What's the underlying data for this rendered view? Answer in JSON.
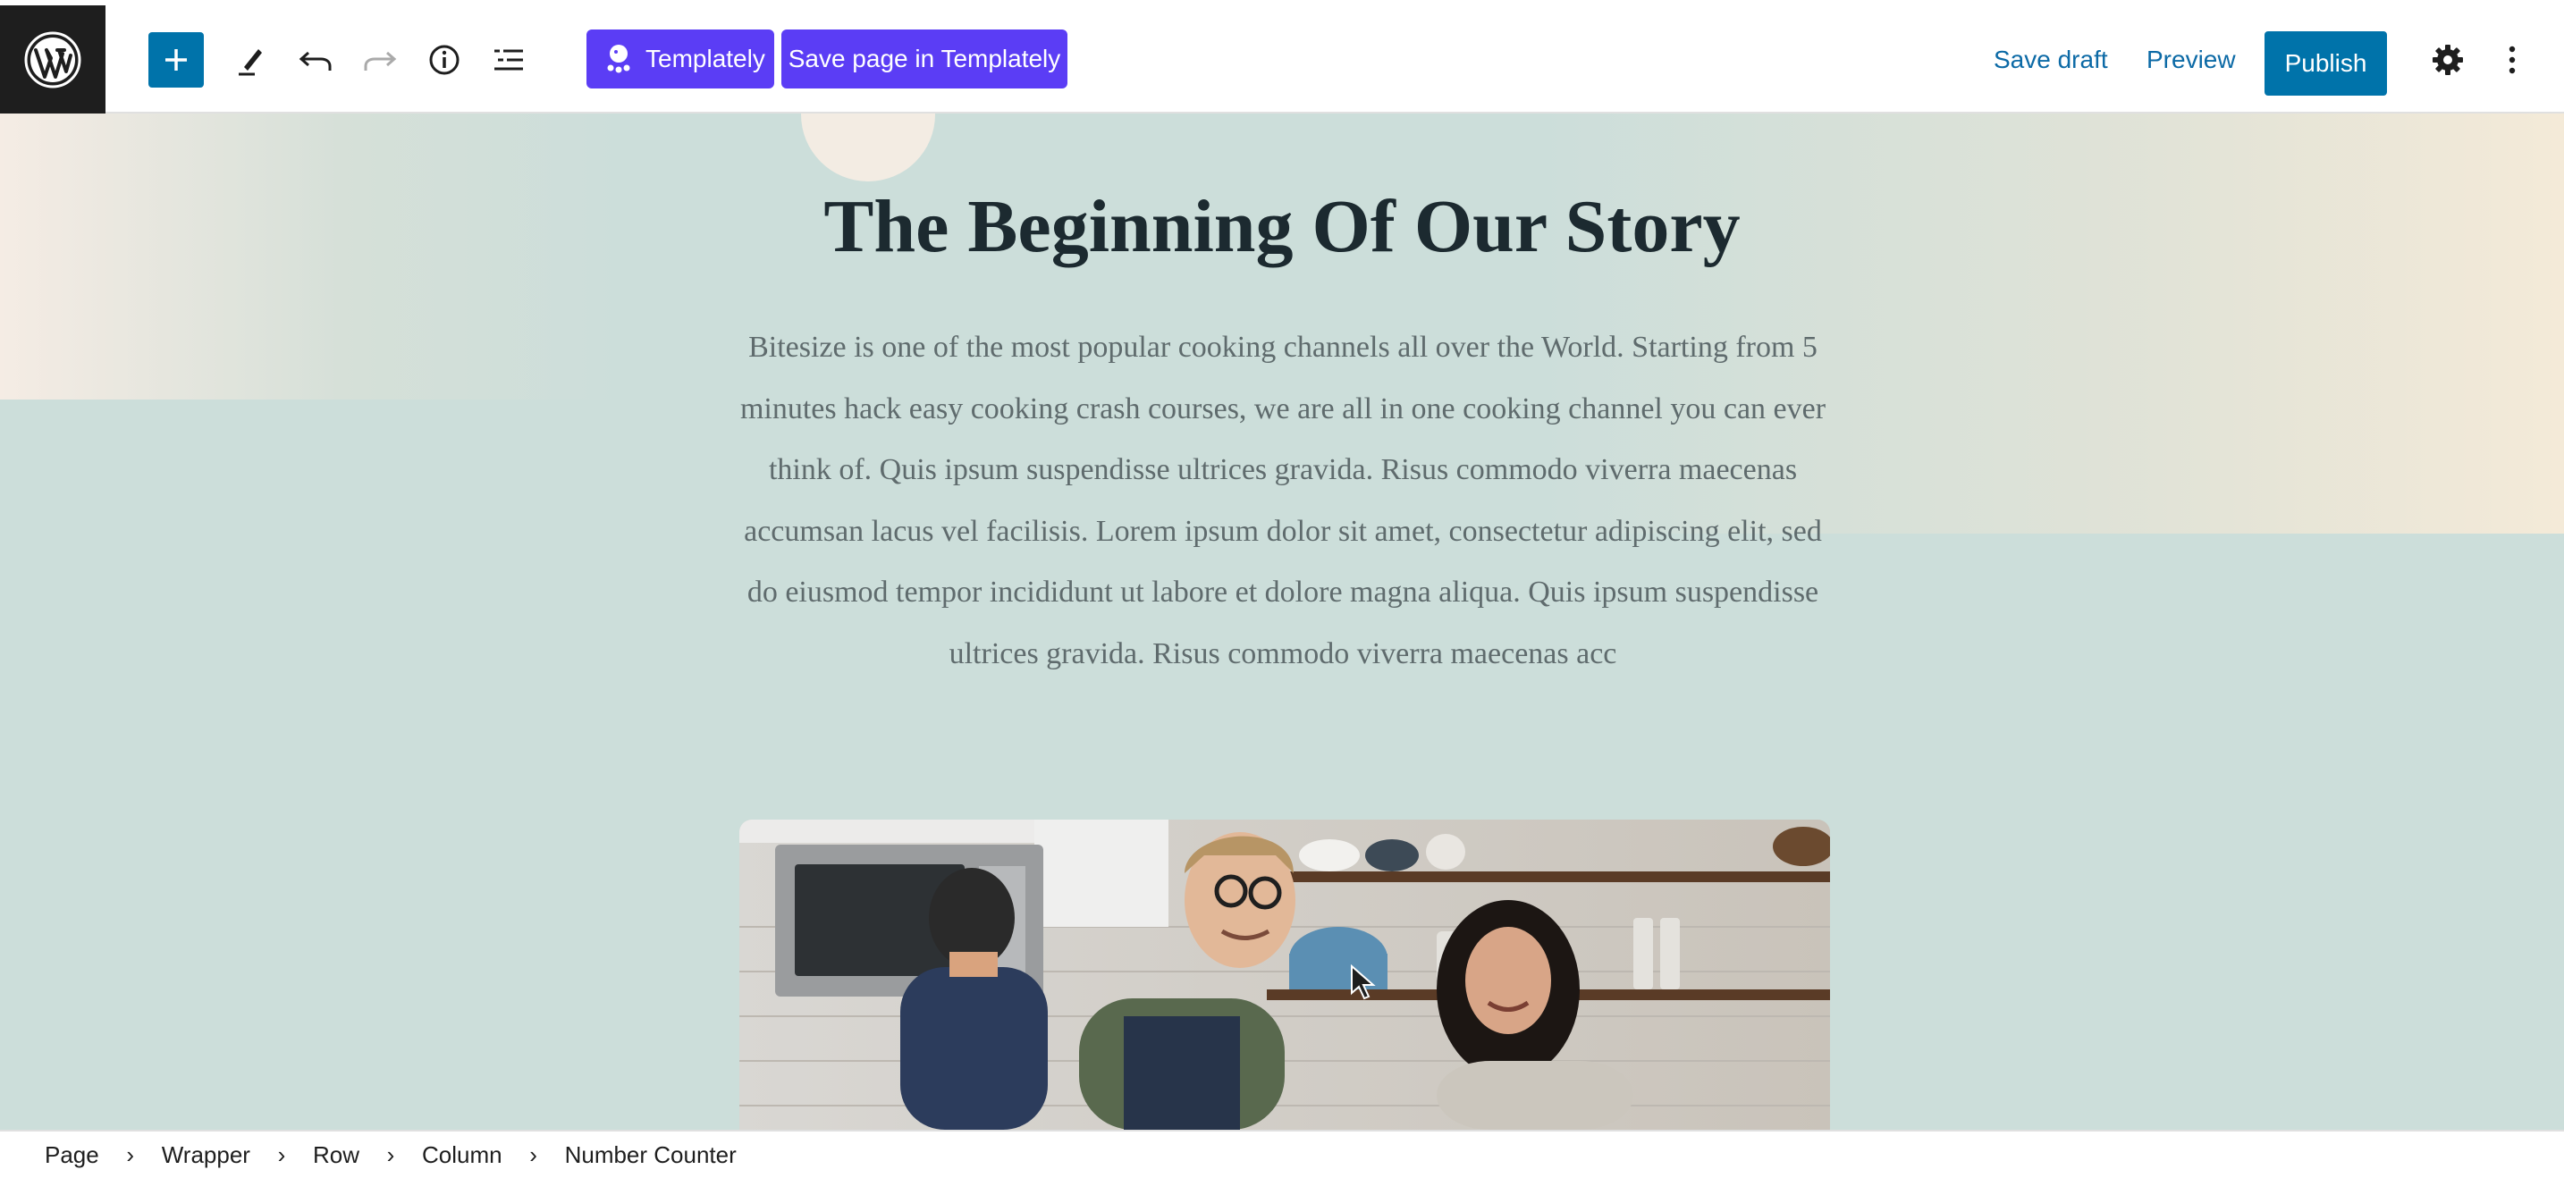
{
  "toolbar": {
    "templately_label": "Templately",
    "save_templately_label": "Save page in Templately",
    "save_draft_label": "Save draft",
    "preview_label": "Preview",
    "publish_label": "Publish"
  },
  "content": {
    "heading": "The Beginning Of Our Story",
    "paragraph": "Bitesize is one of the most popular cooking channels all over the World. Starting from 5 minutes hack easy cooking crash courses, we are all in one cooking channel you can ever think of. Quis ipsum suspendisse ultrices gravida. Risus commodo viverra maecenas accumsan lacus vel facilisis. Lorem ipsum dolor sit amet, consectetur adipiscing elit, sed do eiusmod tempor incididunt ut labore et dolore magna aliqua. Quis ipsum suspendisse ultrices gravida. Risus commodo viverra maecenas acc"
  },
  "breadcrumb": [
    "Page",
    "Wrapper",
    "Row",
    "Column",
    "Number Counter"
  ],
  "colors": {
    "accent": "#0073aa",
    "templately": "#5b3df5",
    "canvas_bg": "#ccdeda"
  }
}
